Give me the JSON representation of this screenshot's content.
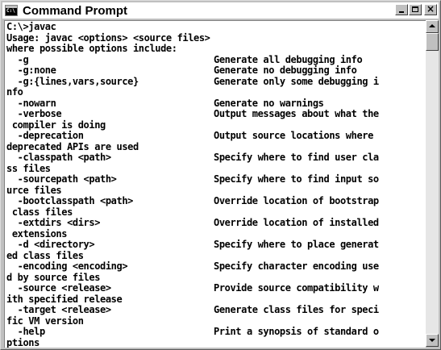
{
  "window": {
    "title": "Command Prompt",
    "icon": "console-icon",
    "controls": {
      "minimize": "minimize-icon",
      "maximize": "maximize-icon",
      "close": "close-icon"
    }
  },
  "console": {
    "lines": [
      {
        "cmd": "C:\\>javac",
        "desc": ""
      },
      {
        "cmd": "Usage: javac <options> <source files>",
        "desc": ""
      },
      {
        "cmd": "where possible options include:",
        "desc": ""
      },
      {
        "cmd": "  -g",
        "desc": "Generate all debugging info"
      },
      {
        "cmd": "  -g:none",
        "desc": "Generate no debugging info"
      },
      {
        "cmd": "  -g:{lines,vars,source}",
        "desc": "Generate only some debugging i"
      },
      {
        "cmd": "nfo",
        "desc": ""
      },
      {
        "cmd": "  -nowarn",
        "desc": "Generate no warnings"
      },
      {
        "cmd": "  -verbose",
        "desc": "Output messages about what the"
      },
      {
        "cmd": " compiler is doing",
        "desc": ""
      },
      {
        "cmd": "  -deprecation",
        "desc": "Output source locations where"
      },
      {
        "cmd": "deprecated APIs are used",
        "desc": ""
      },
      {
        "cmd": "  -classpath <path>",
        "desc": "Specify where to find user cla"
      },
      {
        "cmd": "ss files",
        "desc": ""
      },
      {
        "cmd": "  -sourcepath <path>",
        "desc": "Specify where to find input so"
      },
      {
        "cmd": "urce files",
        "desc": ""
      },
      {
        "cmd": "  -bootclasspath <path>",
        "desc": "Override location of bootstrap"
      },
      {
        "cmd": " class files",
        "desc": ""
      },
      {
        "cmd": "  -extdirs <dirs>",
        "desc": "Override location of installed"
      },
      {
        "cmd": " extensions",
        "desc": ""
      },
      {
        "cmd": "  -d <directory>",
        "desc": "Specify where to place generat"
      },
      {
        "cmd": "ed class files",
        "desc": ""
      },
      {
        "cmd": "  -encoding <encoding>",
        "desc": "Specify character encoding use"
      },
      {
        "cmd": "d by source files",
        "desc": ""
      },
      {
        "cmd": "  -source <release>",
        "desc": "Provide source compatibility w"
      },
      {
        "cmd": "ith specified release",
        "desc": ""
      },
      {
        "cmd": "  -target <release>",
        "desc": "Generate class files for speci"
      },
      {
        "cmd": "fic VM version",
        "desc": ""
      },
      {
        "cmd": "  -help",
        "desc": "Print a synopsis of standard o"
      },
      {
        "cmd": "ptions",
        "desc": ""
      }
    ]
  },
  "scrollbar": {
    "up_icon": "scroll-up-arrow-icon",
    "down_icon": "scroll-down-arrow-icon"
  }
}
